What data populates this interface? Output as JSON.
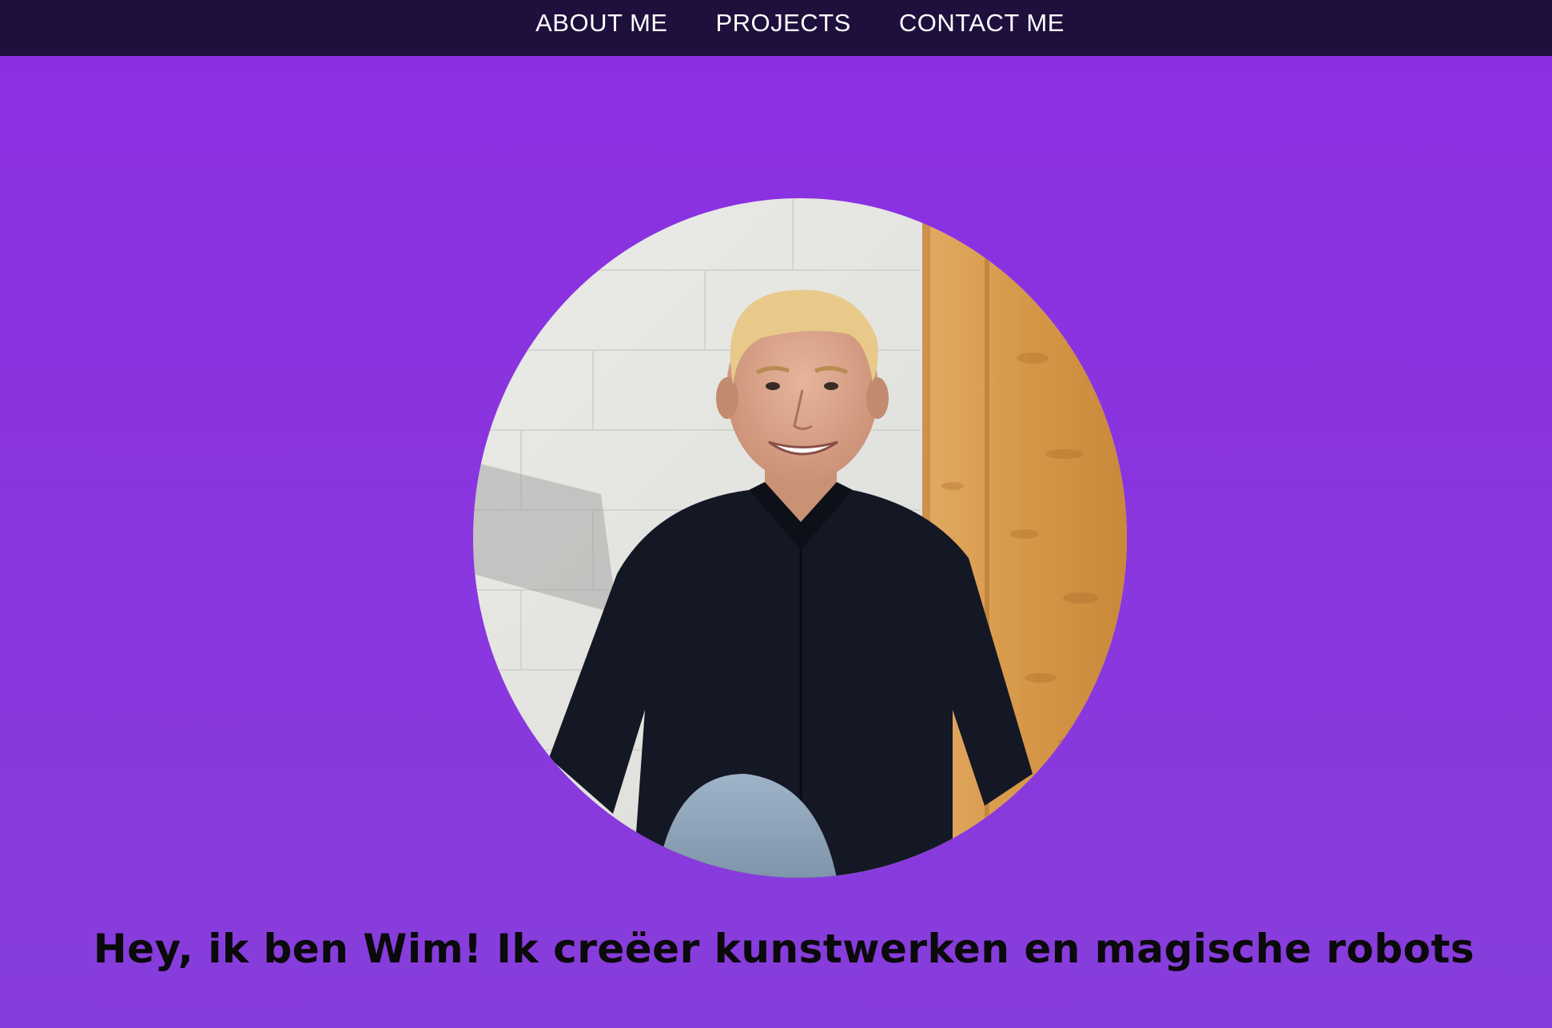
{
  "nav": {
    "items": [
      {
        "label": "ABOUT ME"
      },
      {
        "label": "PROJECTS"
      },
      {
        "label": "CONTACT ME"
      }
    ]
  },
  "hero": {
    "headline": "Hey, ik ben Wim! Ik creëer kunstwerken en magische robots"
  },
  "colors": {
    "nav_background": "#1e0f3c",
    "hero_background": "#8b2fe2",
    "headline_text": "#0a0a0a",
    "nav_text": "#ffffff"
  }
}
